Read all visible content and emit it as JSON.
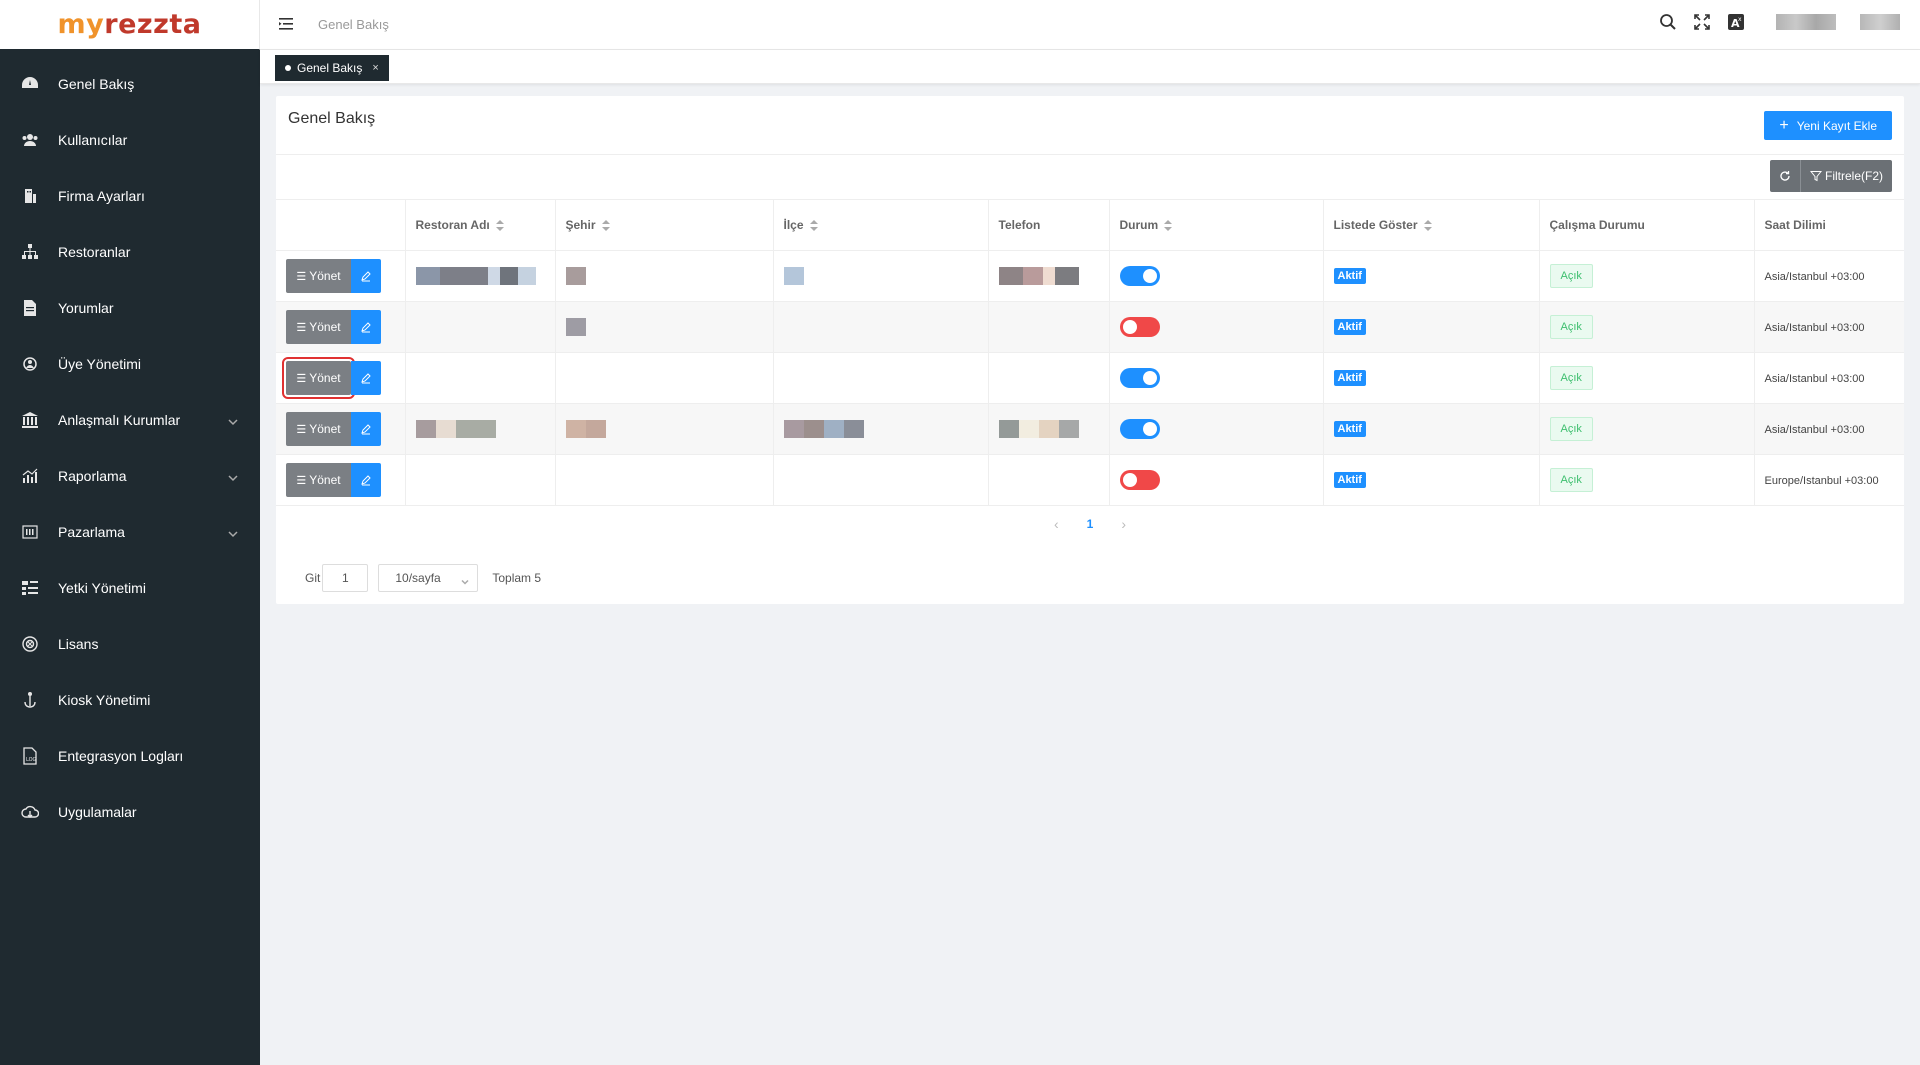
{
  "brand": {
    "my": "my",
    "rest": "rezzta"
  },
  "sidebar": {
    "items": [
      {
        "label": "Genel Bakış",
        "icon": "dashboard-icon",
        "has_children": false
      },
      {
        "label": "Kullanıcılar",
        "icon": "users-icon",
        "has_children": false
      },
      {
        "label": "Firma Ayarları",
        "icon": "building-icon",
        "has_children": false
      },
      {
        "label": "Restoranlar",
        "icon": "sitemap-icon",
        "has_children": false
      },
      {
        "label": "Yorumlar",
        "icon": "document-icon",
        "has_children": false
      },
      {
        "label": "Üye Yönetimi",
        "icon": "member-icon",
        "has_children": false
      },
      {
        "label": "Anlaşmalı Kurumlar",
        "icon": "bank-icon",
        "has_children": true
      },
      {
        "label": "Raporlama",
        "icon": "report-chart-icon",
        "has_children": true
      },
      {
        "label": "Pazarlama",
        "icon": "marketing-icon",
        "has_children": true
      },
      {
        "label": "Yetki Yönetimi",
        "icon": "permission-icon",
        "has_children": false
      },
      {
        "label": "Lisans",
        "icon": "license-icon",
        "has_children": false
      },
      {
        "label": "Kiosk Yönetimi",
        "icon": "kiosk-icon",
        "has_children": false
      },
      {
        "label": "Entegrasyon Logları",
        "icon": "log-icon",
        "has_children": false
      },
      {
        "label": "Uygulamalar",
        "icon": "cloud-icon",
        "has_children": false
      }
    ]
  },
  "header": {
    "breadcrumb": "Genel Bakış"
  },
  "tabs": [
    {
      "label": "Genel Bakış",
      "close": "×"
    }
  ],
  "card": {
    "title": "Genel Bakış",
    "new_button": "Yeni Kayıt Ekle",
    "filter_button": "Filtrele(F2)"
  },
  "table": {
    "columns": [
      "",
      "Restoran Adı",
      "Şehir",
      "İlçe",
      "Telefon",
      "Durum",
      "Listede Göster",
      "Çalışma Durumu",
      "Saat Dilimi"
    ],
    "sortable": [
      false,
      true,
      true,
      true,
      false,
      true,
      true,
      false,
      false
    ],
    "manage_label": "Yönet",
    "rows": [
      {
        "durum": "on",
        "listede": "Aktif",
        "calisma": "Açık",
        "saat": "Asia/Istanbul +03:00"
      },
      {
        "durum": "off",
        "listede": "Aktif",
        "calisma": "Açık",
        "saat": "Asia/Istanbul +03:00"
      },
      {
        "durum": "on",
        "listede": "Aktif",
        "calisma": "Açık",
        "saat": "Asia/Istanbul +03:00"
      },
      {
        "durum": "on",
        "listede": "Aktif",
        "calisma": "Açık",
        "saat": "Asia/Istanbul +03:00"
      },
      {
        "durum": "off",
        "listede": "Aktif",
        "calisma": "Açık",
        "saat": "Europe/Istanbul +03:00"
      }
    ]
  },
  "pagination": {
    "current_page": "1",
    "goto_label": "Git",
    "goto_value": "1",
    "page_size": "10/sayfa",
    "total": "Toplam 5"
  },
  "colors": {
    "sidebar_bg": "#1f2a30",
    "primary": "#1e90ff",
    "danger": "#f04848",
    "success": "#3dbf6e"
  }
}
